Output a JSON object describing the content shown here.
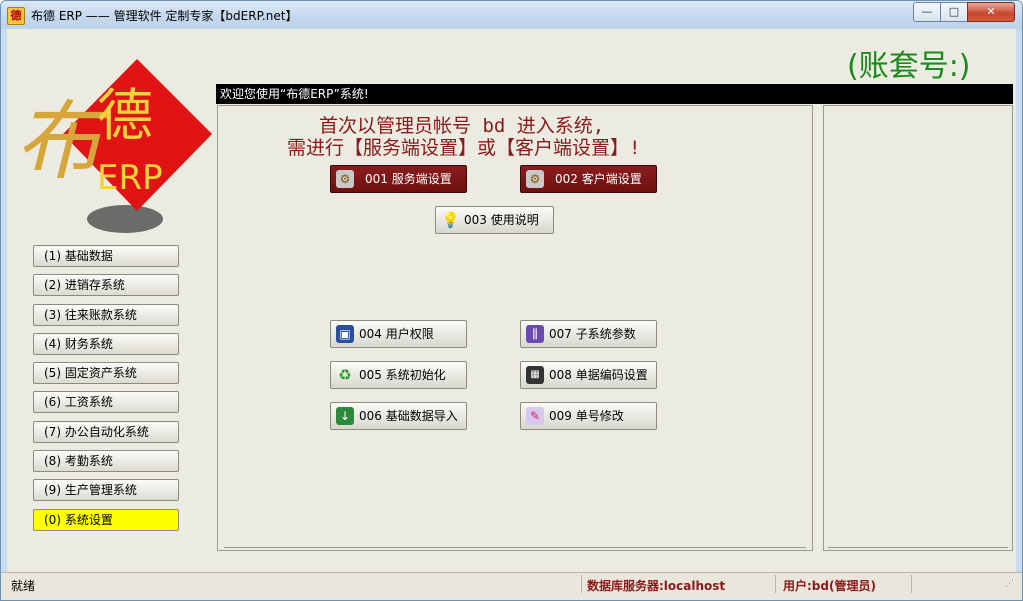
{
  "window": {
    "title": "布德 ERP —— 管理软件 定制专家【bdERP.net】",
    "icon_char": "德"
  },
  "controls": {
    "minimize": "—",
    "maximize": "□",
    "close": "✕"
  },
  "header": {
    "account_label": "(账套号:)"
  },
  "logo": {
    "char1": "布",
    "char2": "德",
    "text": "ERP"
  },
  "sidebar": {
    "items": [
      {
        "label": "(1) 基础数据"
      },
      {
        "label": "(2) 进销存系统"
      },
      {
        "label": "(3) 往来账款系统"
      },
      {
        "label": "(4) 财务系统"
      },
      {
        "label": "(5) 固定资产系统"
      },
      {
        "label": "(6) 工资系统"
      },
      {
        "label": "(7) 办公自动化系统"
      },
      {
        "label": "(8) 考勤系统"
      },
      {
        "label": "(9) 生产管理系统"
      },
      {
        "label": "(0) 系统设置",
        "active": true
      }
    ]
  },
  "main": {
    "welcome": "欢迎您使用“布德ERP”系统!",
    "message_line1": "首次以管理员帐号 bd 进入系统,",
    "message_line2": "需进行【服务端设置】或【客户端设置】!",
    "buttons": {
      "b001": "001 服务端设置",
      "b002": "002 客户端设置",
      "b003": "003 使用说明",
      "b004": "004 用户权限",
      "b005": "005 系统初始化",
      "b006": "006 基础数据导入",
      "b007": "007 子系统参数",
      "b008": "008 单据编码设置",
      "b009": "009 单号修改"
    }
  },
  "status": {
    "ready": "就绪",
    "server": "数据库服务器:localhost",
    "user": "用户:bd(管理员)"
  },
  "colors": {
    "accent_red": "#8a1a1a",
    "account_green": "#1a8a1a",
    "active_yellow": "#ffff00"
  }
}
